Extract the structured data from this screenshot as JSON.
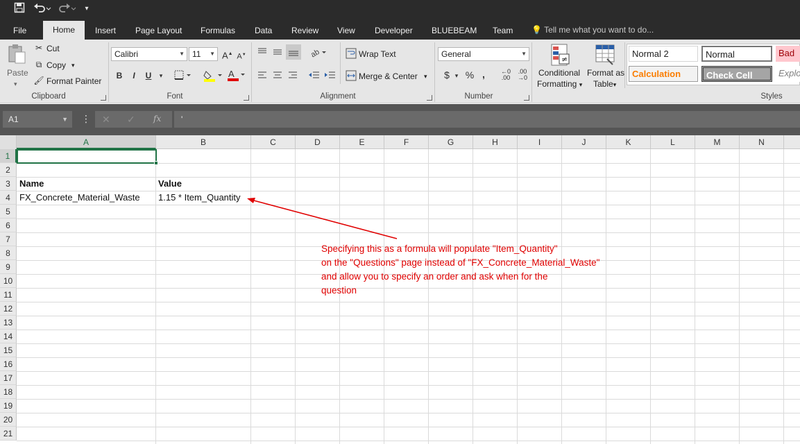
{
  "qat": {
    "save_icon": "save-icon",
    "undo_icon": "undo-icon",
    "redo_icon": "redo-icon",
    "customize_icon": "customize-icon"
  },
  "tabs": [
    {
      "label": "File"
    },
    {
      "label": "Home"
    },
    {
      "label": "Insert"
    },
    {
      "label": "Page Layout"
    },
    {
      "label": "Formulas"
    },
    {
      "label": "Data"
    },
    {
      "label": "Review"
    },
    {
      "label": "View"
    },
    {
      "label": "Developer"
    },
    {
      "label": "BLUEBEAM"
    },
    {
      "label": "Team"
    }
  ],
  "tell_me": "Tell me what you want to do...",
  "ribbon": {
    "clipboard": {
      "paste": "Paste",
      "cut": "Cut",
      "copy": "Copy",
      "format_painter": "Format Painter",
      "label": "Clipboard"
    },
    "font": {
      "family": "Calibri",
      "size": "11",
      "bold": "B",
      "italic": "I",
      "underline": "U",
      "label": "Font"
    },
    "alignment": {
      "wrap_text": "Wrap Text",
      "merge_center": "Merge & Center",
      "label": "Alignment"
    },
    "number": {
      "format": "General",
      "currency": "$",
      "percent": "%",
      "comma": ",",
      "label": "Number"
    },
    "styles": {
      "conditional_1": "Conditional",
      "conditional_2": "Formatting",
      "format_as_1": "Format as",
      "format_as_2": "Table",
      "normal2": "Normal 2",
      "normal": "Normal",
      "bad": "Bad",
      "calculation": "Calculation",
      "check_cell": "Check Cell",
      "explanatory": "Explo",
      "label": "Styles"
    }
  },
  "formula_bar": {
    "name_box": "A1",
    "fx": "fx",
    "content": "'"
  },
  "grid": {
    "columns": [
      "A",
      "B",
      "C",
      "D",
      "E",
      "F",
      "G",
      "H",
      "I",
      "J",
      "K",
      "L",
      "M",
      "N"
    ],
    "rows": [
      "1",
      "2",
      "3",
      "4",
      "5",
      "6",
      "7",
      "8",
      "9",
      "10",
      "11",
      "12",
      "13",
      "14",
      "15",
      "16",
      "17",
      "18",
      "19",
      "20",
      "21"
    ],
    "cells": {
      "A3": "Name",
      "B3": "Value",
      "A4": "FX_Concrete_Material_Waste",
      "B4": "1.15 * Item_Quantity"
    }
  },
  "annotation": {
    "lines": [
      "Specifying this as a formula will populate \"Item_Quantity\"",
      "on the \"Questions\" page instead of \"FX_Concrete_Material_Waste\"",
      "and allow you to specify an order and ask when for the",
      "question"
    ],
    "color": "#e00000"
  },
  "colors": {
    "accent": "#217346",
    "ribbon_bg": "#e6e6e6",
    "titlebar_bg": "#2b2b2b"
  }
}
